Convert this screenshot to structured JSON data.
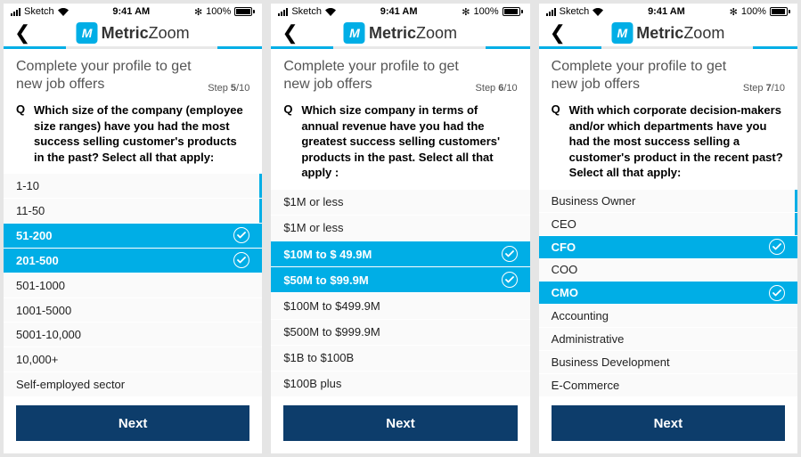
{
  "status": {
    "carrier": "Sketch",
    "time": "9:41 AM",
    "battery": "100%"
  },
  "brand": {
    "name": "Metric",
    "suffix": "Zoom"
  },
  "heading": "Complete your profile to get new job offers",
  "step_prefix": "Step ",
  "step_total": "/10",
  "next_label": "Next",
  "screens": [
    {
      "step": "5",
      "question": "Which size of the company  (employee size ranges) have you had the most success selling customer's  products in the past? Select all that apply:",
      "options": [
        {
          "label": "1-10",
          "selected": false,
          "alt": true
        },
        {
          "label": "11-50",
          "selected": false,
          "alt": true
        },
        {
          "label": "51-200",
          "selected": true
        },
        {
          "label": "201-500",
          "selected": true
        },
        {
          "label": "501-1000",
          "selected": false
        },
        {
          "label": "1001-5000",
          "selected": false
        },
        {
          "label": "5001-10,000",
          "selected": false
        },
        {
          "label": "10,000+",
          "selected": false
        },
        {
          "label": "Self-employed sector",
          "selected": false
        }
      ]
    },
    {
      "step": "6",
      "question": "Which size company in terms of annual revenue  have you had the greatest success selling customers' products in the past. Select all that apply :",
      "options": [
        {
          "label": "$1M or less",
          "selected": false
        },
        {
          "label": "$1M or less",
          "selected": false
        },
        {
          "label": "$10M to $ 49.9M",
          "selected": true
        },
        {
          "label": "$50M to $99.9M",
          "selected": true
        },
        {
          "label": "$100M to $499.9M",
          "selected": false
        },
        {
          "label": "$500M to $999.9M",
          "selected": false
        },
        {
          "label": "$1B to $100B",
          "selected": false
        },
        {
          "label": "$100B plus",
          "selected": false
        }
      ]
    },
    {
      "step": "7",
      "question": "With which corporate decision-makers and/or which departments have you had the most success selling a customer's  product in the recent past? Select all that apply:",
      "options": [
        {
          "label": "Business Owner",
          "selected": false,
          "alt": true
        },
        {
          "label": "CEO",
          "selected": false,
          "alt": true
        },
        {
          "label": "CFO",
          "selected": true
        },
        {
          "label": "COO",
          "selected": false
        },
        {
          "label": "CMO",
          "selected": true
        },
        {
          "label": "Accounting",
          "selected": false
        },
        {
          "label": "Administrative",
          "selected": false
        },
        {
          "label": "Business Development",
          "selected": false
        },
        {
          "label": "E-Commerce",
          "selected": false
        }
      ]
    }
  ]
}
